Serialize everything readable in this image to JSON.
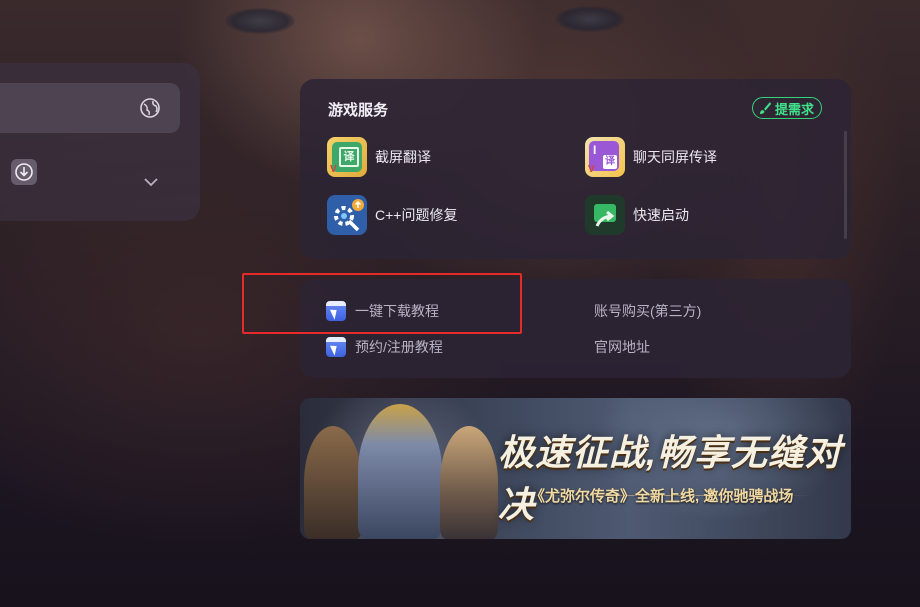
{
  "services": {
    "title": "游戏服务",
    "request_badge": "提需求",
    "items": [
      {
        "label": "截屏翻译",
        "icon": "screenshot-translate-icon"
      },
      {
        "label": "聊天同屏传译",
        "icon": "chat-translate-icon"
      },
      {
        "label": "C++问题修复",
        "icon": "cpp-repair-icon"
      },
      {
        "label": "快速启动",
        "icon": "quick-launch-icon"
      }
    ]
  },
  "tutorials": {
    "items": [
      {
        "label": "一键下载教程",
        "icon": "www-icon"
      },
      {
        "label": "账号购买(第三方)"
      },
      {
        "label": "预约/注册教程",
        "icon": "www-icon"
      },
      {
        "label": "官网地址"
      }
    ]
  },
  "banner": {
    "headline": "极速征战,畅享无缝对决",
    "subline": "《尤弥尔传奇》全新上线, 邀你驰骋战场"
  },
  "colors": {
    "highlight_border": "#e62a2a",
    "request_badge": "#34d27a",
    "panel_bg": "#2c2434"
  }
}
